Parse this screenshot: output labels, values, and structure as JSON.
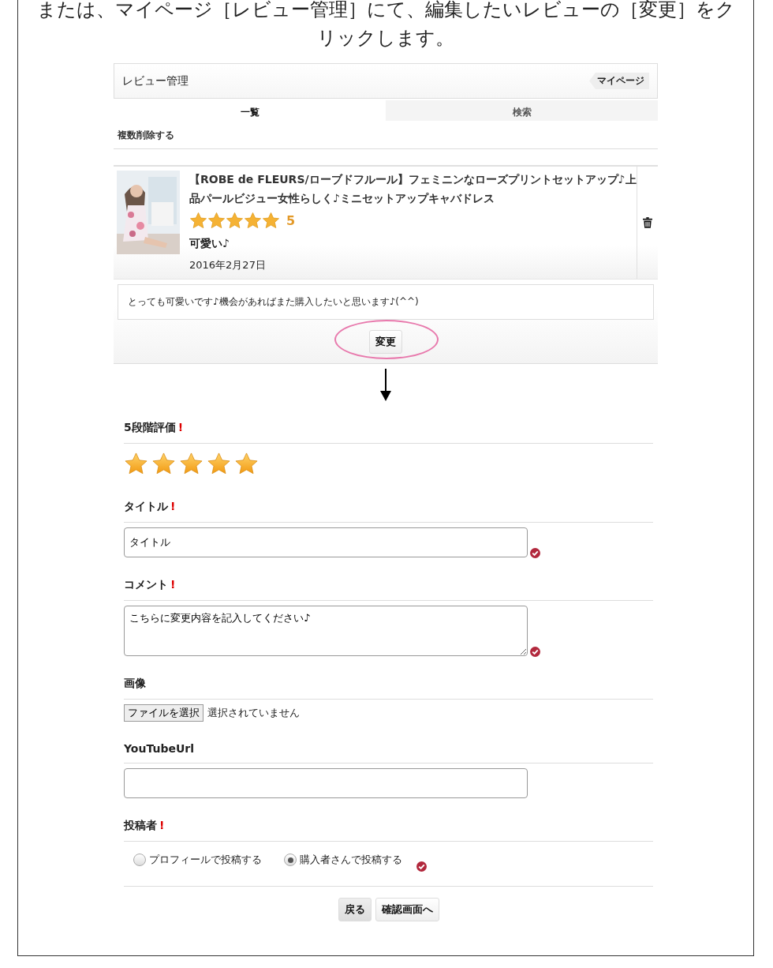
{
  "instruction": "または、マイページ［レビュー管理］にて、編集したいレビューの［変更］をクリックします。",
  "review_manager": {
    "title": "レビュー管理",
    "mypage_link": "マイページ",
    "tabs": [
      {
        "label": "一覧",
        "selected": true
      },
      {
        "label": "検索",
        "selected": false
      }
    ],
    "bulk_delete": "複数削除する",
    "review": {
      "product_title": "【ROBE de FLEURS/ローブドフルール】フェミニンなローズプリントセットアップ♪上品パールビジュー女性らしく♪ミニセットアップキャバドレス",
      "stars": 5,
      "rating": "5",
      "review_title": "可愛い♪",
      "date": "2016年2月27日",
      "comment": "とっても可愛いです♪機会があればまた購入したいと思います♪(^^)",
      "edit_button": "変更",
      "highlighted": true
    }
  },
  "form": {
    "fields": [
      {
        "kind": "rating",
        "label": "5段階評価",
        "mark": "!",
        "stars": 5
      },
      {
        "kind": "text",
        "label": "タイトル",
        "mark": "!",
        "value": "タイトル",
        "valid": true
      },
      {
        "kind": "textarea",
        "label": "コメント",
        "mark": "!",
        "value": "こちらに変更内容を記入してください♪",
        "valid": true
      },
      {
        "kind": "file",
        "label": "画像",
        "button": "ファイルを選択",
        "status": "選択されていません"
      },
      {
        "kind": "text",
        "label": "YouTubeUrl"
      },
      {
        "kind": "radio",
        "label": "投稿者",
        "mark": "!",
        "valid": true,
        "options": [
          {
            "label": "プロフィールで投稿する",
            "selected": false
          },
          {
            "label": "購入者さんで投稿する",
            "selected": true
          }
        ]
      }
    ],
    "buttons": [
      "戻る",
      "確認画面へ"
    ]
  }
}
